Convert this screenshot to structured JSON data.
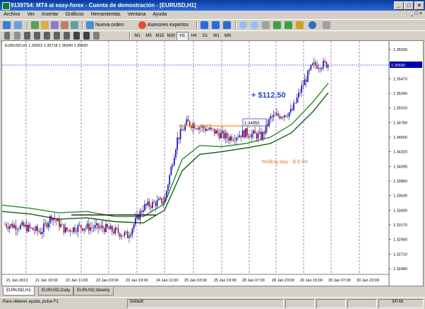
{
  "window": {
    "title": "9139754: MT4 at easy-forex - Cuenta de demostración - [EURUSD,H1]"
  },
  "menu": [
    "Archivo",
    "Ver",
    "Insertar",
    "Gráficos",
    "Herramientas",
    "Ventana",
    "Ayuda"
  ],
  "toolbar": {
    "new_order": "Nueva orden",
    "experts": "Asesores expertos"
  },
  "timeframes": [
    "M1",
    "M5",
    "M15",
    "M30",
    "H1",
    "H4",
    "D1",
    "W1",
    "MN"
  ],
  "active_timeframe": "H1",
  "chart": {
    "info": "EURUSD,H1  1.35653 1.35718 1.35640 1.35690",
    "profit_label": "+ $112.50",
    "rolling_label": "Rolling day - $ 6.00",
    "price_box": "1.34955",
    "current_price": "1.35690",
    "y_ticks": [
      "1.35930",
      "1.35700",
      "1.35240",
      "1.34780",
      "1.34550",
      "1.34320",
      "1.34090",
      "1.33860",
      "1.33630",
      "1.33400",
      "1.33170",
      "1.32940",
      "1.32710",
      "1.32480"
    ],
    "y_ticks_raw": [
      "1.35930",
      "1.35700",
      "1.35470",
      "1.35240",
      "1.35010",
      "1.34780",
      "1.34550",
      "1.34320",
      "1.34090",
      "1.33860",
      "1.33630",
      "1.33400",
      "1.33170",
      "1.32940",
      "1.32710",
      "1.32480"
    ],
    "x_ticks": [
      "21 Jan 2013",
      "21 Jan 19:00",
      "22 Jan 11:00",
      "23 Jan 03:00",
      "23 Jan 19:00",
      "24 Jan 11:00",
      "25 Jan 03:00",
      "25 Jan 19:00",
      "28 Jan 07:00",
      "28 Jan 23:00",
      "29 Jan 15:00",
      "30 Jan 07:00",
      "30 Jan 23:00"
    ],
    "colors": {
      "candle_up": "#0000cc",
      "candle_down": "#cc0000",
      "ma_fast": "#2c8a2c",
      "ma_slow": "#0f5f0f",
      "vline": "#8a5aa8",
      "resistance": "#ff8c00",
      "support": "#000000",
      "price": "#0000aa"
    }
  },
  "tabs": [
    "EURUSD,H1",
    "EURUSD,Daily",
    "EURUSD,Weekly"
  ],
  "status": {
    "help": "Para obtener ayuda, pulse F1",
    "profile": "Default",
    "traffic": "3/0 kb"
  }
}
